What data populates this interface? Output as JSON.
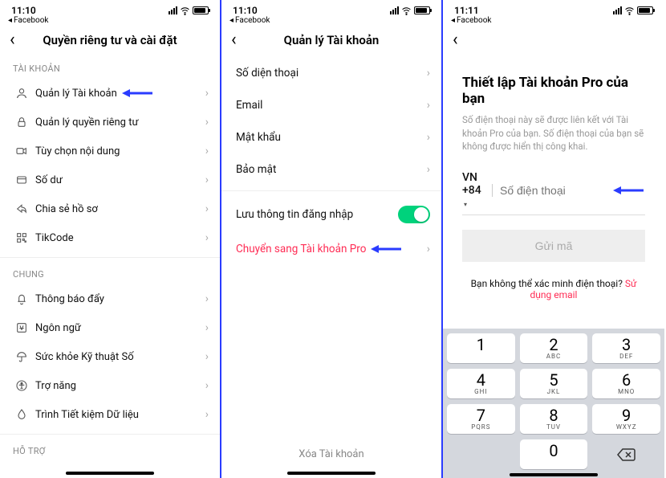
{
  "status": {
    "time1": "11:10",
    "time2": "11:10",
    "time3": "11:11",
    "back_app": "Facebook"
  },
  "screen1": {
    "title": "Quyền riêng tư và cài đặt",
    "sections": {
      "account": {
        "label": "TÀI KHOẢN",
        "items": [
          {
            "label": "Quản lý Tài khoản"
          },
          {
            "label": "Quản lý quyền riêng tư"
          },
          {
            "label": "Tùy chọn nội dung"
          },
          {
            "label": "Số dư"
          },
          {
            "label": "Chia sẻ hồ sơ"
          },
          {
            "label": "TikCode"
          }
        ]
      },
      "general": {
        "label": "CHUNG",
        "items": [
          {
            "label": "Thông báo đẩy"
          },
          {
            "label": "Ngôn ngữ"
          },
          {
            "label": "Sức khỏe Kỹ thuật Số"
          },
          {
            "label": "Trợ năng"
          },
          {
            "label": "Trình Tiết kiệm Dữ liệu"
          }
        ]
      },
      "support": {
        "label": "HỖ TRỢ"
      }
    }
  },
  "screen2": {
    "title": "Quản lý Tài khoản",
    "items": [
      {
        "label": "Số diện thoại"
      },
      {
        "label": "Email"
      },
      {
        "label": "Mật khẩu"
      },
      {
        "label": "Bảo mật"
      }
    ],
    "save_login": "Lưu thông tin đăng nhập",
    "switch_pro": "Chuyển sang Tài khoản Pro",
    "delete": "Xóa Tài khoản"
  },
  "screen3": {
    "title": "Thiết lập Tài khoản Pro của bạn",
    "desc": "Số điện thoại này sẽ được liên kết với Tài khoản Pro của bạn. Số điện thoại của bạn sẽ không được hiển thị công khai.",
    "country_code": "VN +84",
    "phone_placeholder": "Số điện thoại",
    "send": "Gửi mã",
    "verify_q": "Bạn không thể xác minh điện thoại? ",
    "verify_link": "Sử dụng email",
    "keypad": {
      "k1": {
        "n": "1",
        "l": ""
      },
      "k2": {
        "n": "2",
        "l": "ABC"
      },
      "k3": {
        "n": "3",
        "l": "DEF"
      },
      "k4": {
        "n": "4",
        "l": "GHI"
      },
      "k5": {
        "n": "5",
        "l": "JKL"
      },
      "k6": {
        "n": "6",
        "l": "MNO"
      },
      "k7": {
        "n": "7",
        "l": "PQRS"
      },
      "k8": {
        "n": "8",
        "l": "TUV"
      },
      "k9": {
        "n": "9",
        "l": "WXYZ"
      },
      "k0": {
        "n": "0",
        "l": ""
      }
    }
  }
}
